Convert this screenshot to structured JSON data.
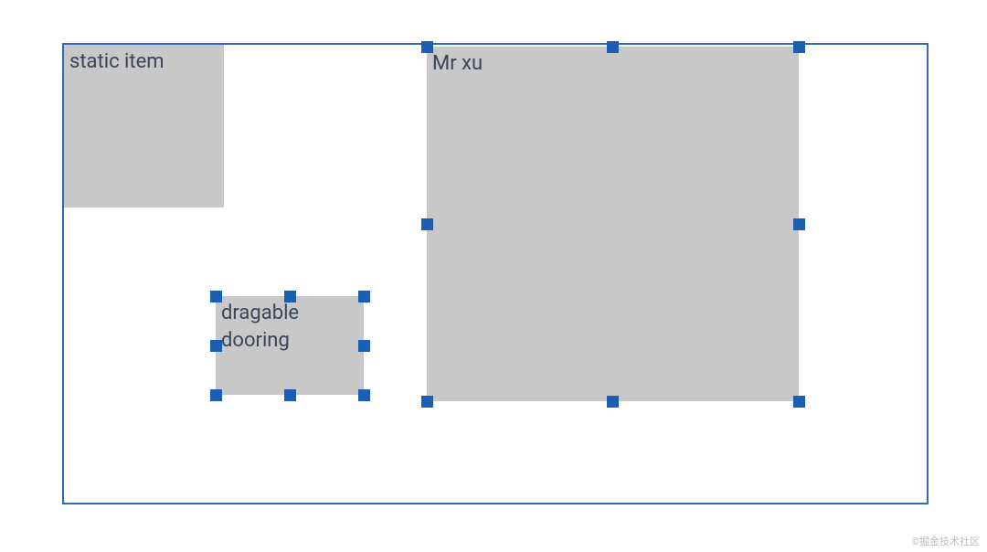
{
  "canvas": {
    "items": [
      {
        "label": "static item",
        "draggable": false
      },
      {
        "label": "dragable dooring",
        "draggable": true
      },
      {
        "label": "Mr xu",
        "draggable": true
      }
    ]
  },
  "watermark": "©掘金技术社区"
}
